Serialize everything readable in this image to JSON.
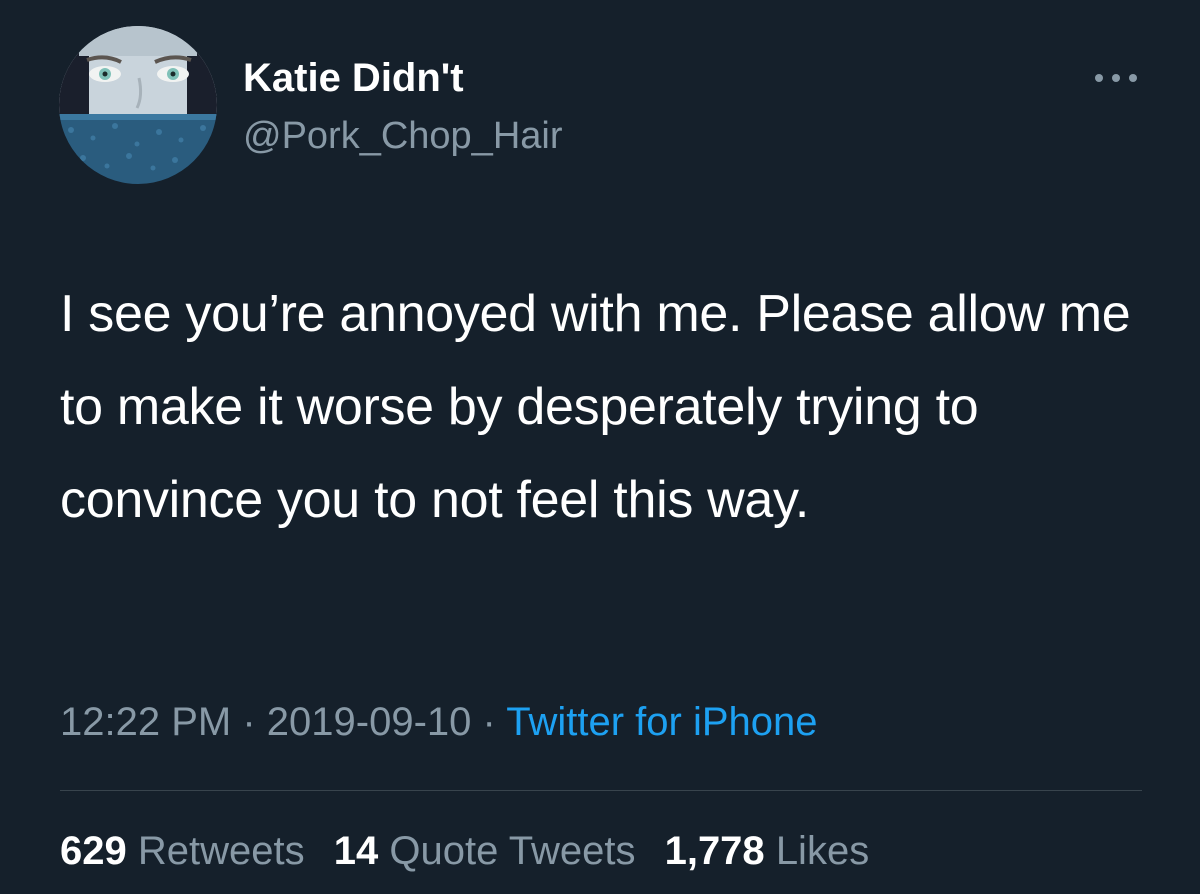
{
  "author": {
    "display_name": "Katie Didn't",
    "handle": "@Pork_Chop_Hair",
    "avatar": "profile-photo-eyes"
  },
  "menu_icon": "more-horizontal-icon",
  "tweet": {
    "text": "I see you’re annoyed with me. Please allow me to make it worse by desperately trying to convince you to not feel this way.",
    "time": "12:22 PM",
    "date": "2019-09-10",
    "separator": "·",
    "source": "Twitter for iPhone"
  },
  "stats": {
    "retweets_count": "629",
    "retweets_label": "Retweets",
    "quotes_count": "14",
    "quotes_label": "Quote Tweets",
    "likes_count": "1,778",
    "likes_label": "Likes"
  },
  "colors": {
    "background": "#15202b",
    "text": "#ffffff",
    "secondary_text": "#8899a6",
    "link": "#1da1f2",
    "divider": "#38444d"
  }
}
